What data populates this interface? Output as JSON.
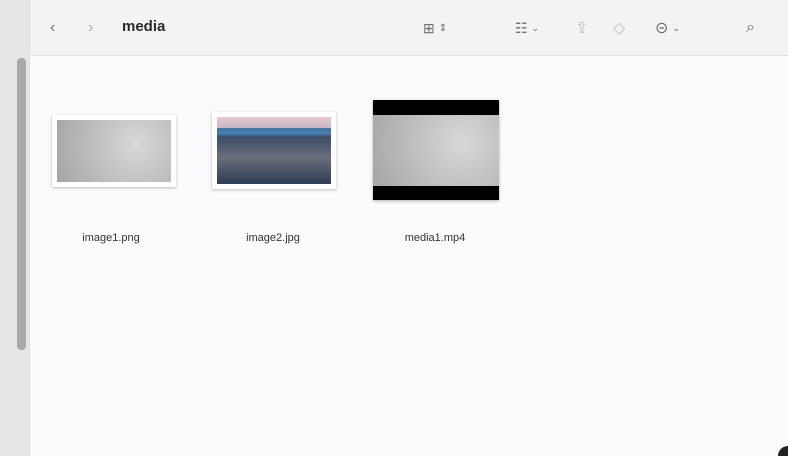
{
  "toolbar": {
    "title": "media",
    "icons": [
      "chevron-left-icon",
      "chevron-right-icon",
      "grid-view-icon",
      "group-icon",
      "share-icon",
      "tag-icon",
      "more-icon",
      "search-icon"
    ]
  },
  "files": [
    {
      "name": "image1.png"
    },
    {
      "name": "image2.jpg"
    },
    {
      "name": "media1.mp4"
    }
  ]
}
